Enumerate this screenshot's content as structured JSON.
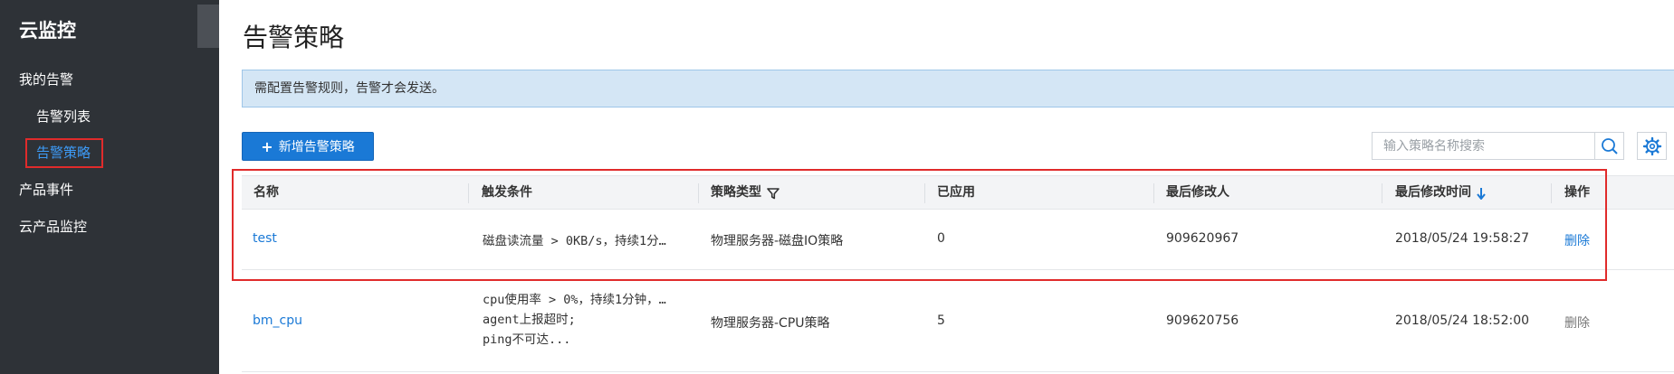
{
  "sidebar": {
    "title": "云监控",
    "items": [
      {
        "label": "我的告警"
      },
      {
        "label": "告警列表"
      },
      {
        "label": "告警策略"
      },
      {
        "label": "产品事件"
      },
      {
        "label": "云产品监控"
      }
    ],
    "active_item": "告警策略"
  },
  "main": {
    "title": "告警策略",
    "notice": "需配置告警规则，告警才会发送。",
    "add_button": {
      "icon": "+",
      "label": "新增告警策略"
    },
    "search": {
      "placeholder": "输入策略名称搜索",
      "value": ""
    },
    "colors": {
      "accent": "#1a79d6",
      "highlight": "#e02b2b",
      "sidebar_bg": "#2e3237"
    }
  },
  "table": {
    "headers": [
      "名称",
      "触发条件",
      "策略类型",
      "已应用",
      "最后修改人",
      "最后修改时间",
      "操作"
    ],
    "rows": [
      {
        "name": "test",
        "condition": [
          "磁盘读流量 > 0KB/s，持续1分…"
        ],
        "type": "物理服务器-磁盘IO策略",
        "applied": "0",
        "modifier": "909620967",
        "modified_time": "2018/05/24 19:58:27",
        "action": "删除"
      },
      {
        "name": "bm_cpu",
        "condition": [
          "cpu使用率 > 0%，持续1分钟，…",
          "agent上报超时;",
          "ping不可达..."
        ],
        "type": "物理服务器-CPU策略",
        "applied": "5",
        "modifier": "909620756",
        "modified_time": "2018/05/24 18:52:00",
        "action": "删除"
      }
    ]
  }
}
